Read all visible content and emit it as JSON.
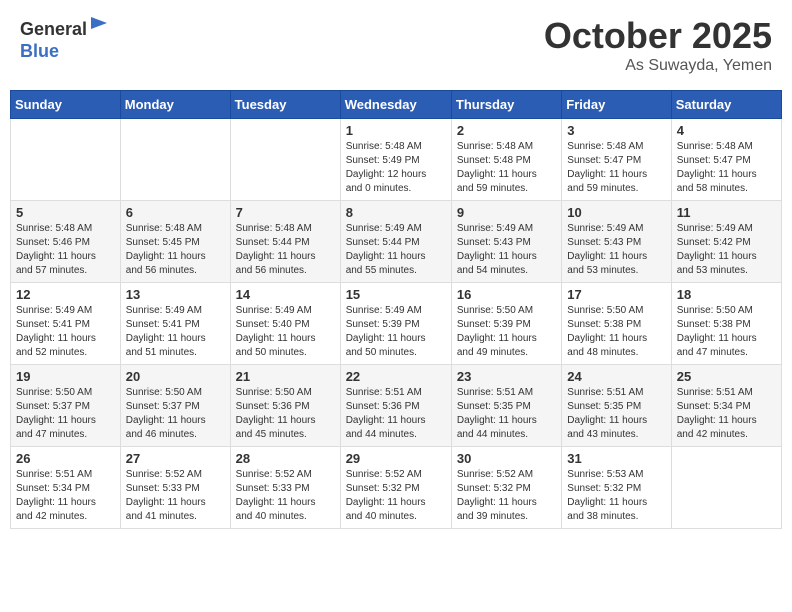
{
  "header": {
    "logo_line1": "General",
    "logo_line2": "Blue",
    "month": "October 2025",
    "location": "As Suwayda, Yemen"
  },
  "weekdays": [
    "Sunday",
    "Monday",
    "Tuesday",
    "Wednesday",
    "Thursday",
    "Friday",
    "Saturday"
  ],
  "weeks": [
    [
      {
        "day": "",
        "info": ""
      },
      {
        "day": "",
        "info": ""
      },
      {
        "day": "",
        "info": ""
      },
      {
        "day": "1",
        "info": "Sunrise: 5:48 AM\nSunset: 5:49 PM\nDaylight: 12 hours\nand 0 minutes."
      },
      {
        "day": "2",
        "info": "Sunrise: 5:48 AM\nSunset: 5:48 PM\nDaylight: 11 hours\nand 59 minutes."
      },
      {
        "day": "3",
        "info": "Sunrise: 5:48 AM\nSunset: 5:47 PM\nDaylight: 11 hours\nand 59 minutes."
      },
      {
        "day": "4",
        "info": "Sunrise: 5:48 AM\nSunset: 5:47 PM\nDaylight: 11 hours\nand 58 minutes."
      }
    ],
    [
      {
        "day": "5",
        "info": "Sunrise: 5:48 AM\nSunset: 5:46 PM\nDaylight: 11 hours\nand 57 minutes."
      },
      {
        "day": "6",
        "info": "Sunrise: 5:48 AM\nSunset: 5:45 PM\nDaylight: 11 hours\nand 56 minutes."
      },
      {
        "day": "7",
        "info": "Sunrise: 5:48 AM\nSunset: 5:44 PM\nDaylight: 11 hours\nand 56 minutes."
      },
      {
        "day": "8",
        "info": "Sunrise: 5:49 AM\nSunset: 5:44 PM\nDaylight: 11 hours\nand 55 minutes."
      },
      {
        "day": "9",
        "info": "Sunrise: 5:49 AM\nSunset: 5:43 PM\nDaylight: 11 hours\nand 54 minutes."
      },
      {
        "day": "10",
        "info": "Sunrise: 5:49 AM\nSunset: 5:43 PM\nDaylight: 11 hours\nand 53 minutes."
      },
      {
        "day": "11",
        "info": "Sunrise: 5:49 AM\nSunset: 5:42 PM\nDaylight: 11 hours\nand 53 minutes."
      }
    ],
    [
      {
        "day": "12",
        "info": "Sunrise: 5:49 AM\nSunset: 5:41 PM\nDaylight: 11 hours\nand 52 minutes."
      },
      {
        "day": "13",
        "info": "Sunrise: 5:49 AM\nSunset: 5:41 PM\nDaylight: 11 hours\nand 51 minutes."
      },
      {
        "day": "14",
        "info": "Sunrise: 5:49 AM\nSunset: 5:40 PM\nDaylight: 11 hours\nand 50 minutes."
      },
      {
        "day": "15",
        "info": "Sunrise: 5:49 AM\nSunset: 5:39 PM\nDaylight: 11 hours\nand 50 minutes."
      },
      {
        "day": "16",
        "info": "Sunrise: 5:50 AM\nSunset: 5:39 PM\nDaylight: 11 hours\nand 49 minutes."
      },
      {
        "day": "17",
        "info": "Sunrise: 5:50 AM\nSunset: 5:38 PM\nDaylight: 11 hours\nand 48 minutes."
      },
      {
        "day": "18",
        "info": "Sunrise: 5:50 AM\nSunset: 5:38 PM\nDaylight: 11 hours\nand 47 minutes."
      }
    ],
    [
      {
        "day": "19",
        "info": "Sunrise: 5:50 AM\nSunset: 5:37 PM\nDaylight: 11 hours\nand 47 minutes."
      },
      {
        "day": "20",
        "info": "Sunrise: 5:50 AM\nSunset: 5:37 PM\nDaylight: 11 hours\nand 46 minutes."
      },
      {
        "day": "21",
        "info": "Sunrise: 5:50 AM\nSunset: 5:36 PM\nDaylight: 11 hours\nand 45 minutes."
      },
      {
        "day": "22",
        "info": "Sunrise: 5:51 AM\nSunset: 5:36 PM\nDaylight: 11 hours\nand 44 minutes."
      },
      {
        "day": "23",
        "info": "Sunrise: 5:51 AM\nSunset: 5:35 PM\nDaylight: 11 hours\nand 44 minutes."
      },
      {
        "day": "24",
        "info": "Sunrise: 5:51 AM\nSunset: 5:35 PM\nDaylight: 11 hours\nand 43 minutes."
      },
      {
        "day": "25",
        "info": "Sunrise: 5:51 AM\nSunset: 5:34 PM\nDaylight: 11 hours\nand 42 minutes."
      }
    ],
    [
      {
        "day": "26",
        "info": "Sunrise: 5:51 AM\nSunset: 5:34 PM\nDaylight: 11 hours\nand 42 minutes."
      },
      {
        "day": "27",
        "info": "Sunrise: 5:52 AM\nSunset: 5:33 PM\nDaylight: 11 hours\nand 41 minutes."
      },
      {
        "day": "28",
        "info": "Sunrise: 5:52 AM\nSunset: 5:33 PM\nDaylight: 11 hours\nand 40 minutes."
      },
      {
        "day": "29",
        "info": "Sunrise: 5:52 AM\nSunset: 5:32 PM\nDaylight: 11 hours\nand 40 minutes."
      },
      {
        "day": "30",
        "info": "Sunrise: 5:52 AM\nSunset: 5:32 PM\nDaylight: 11 hours\nand 39 minutes."
      },
      {
        "day": "31",
        "info": "Sunrise: 5:53 AM\nSunset: 5:32 PM\nDaylight: 11 hours\nand 38 minutes."
      },
      {
        "day": "",
        "info": ""
      }
    ]
  ]
}
